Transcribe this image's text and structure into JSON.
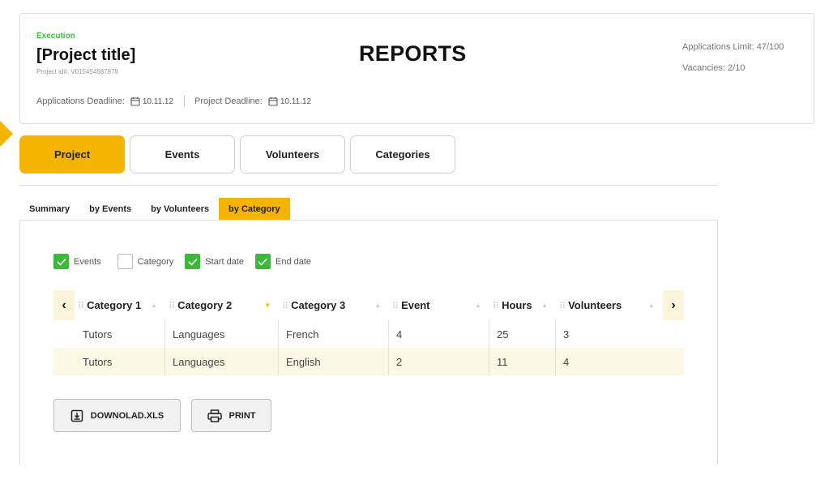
{
  "header": {
    "status": "Execution",
    "project_title": "[Project title]",
    "project_id": "Project id#: V015454587878",
    "applications_deadline_label": "Applications Deadline:",
    "applications_deadline_date": "10.11.12",
    "project_deadline_label": "Project Deadline:",
    "project_deadline_date": "10.11.12",
    "page_heading": "REPORTS",
    "applications_limit": "Applications Limit:  47/100",
    "vacancies": "Vacancies:  2/10"
  },
  "main_tabs": [
    "Project",
    "Events",
    "Volunteers",
    "Categories"
  ],
  "main_tab_active": "Project",
  "sub_tabs": [
    "Summary",
    "by Events",
    "by Volunteers",
    "by Category"
  ],
  "sub_tab_active": "by Category",
  "filters": [
    {
      "label": "Events",
      "checked": true
    },
    {
      "label": "Category",
      "checked": false
    },
    {
      "label": "Start date",
      "checked": true
    },
    {
      "label": "End date",
      "checked": true
    }
  ],
  "table": {
    "nav_prev": "‹",
    "nav_next": "›",
    "columns": [
      "Category 1",
      "Category 2",
      "Category 3",
      "Event",
      "Hours",
      "Volunteers"
    ],
    "sorted_column": "Category 2",
    "rows": [
      [
        "Tutors",
        "Languages",
        "French",
        "4",
        "25",
        "3"
      ],
      [
        "Tutors",
        "Languages",
        "English",
        "2",
        "11",
        "4"
      ]
    ]
  },
  "buttons": {
    "download": "DOWNOLAD.XLS",
    "print": "PRINT"
  },
  "colors": {
    "accent": "#f4b400",
    "status_green": "#3cc13b",
    "checkbox_green": "#3cb93a",
    "row_highlight": "#fdf7e5"
  }
}
